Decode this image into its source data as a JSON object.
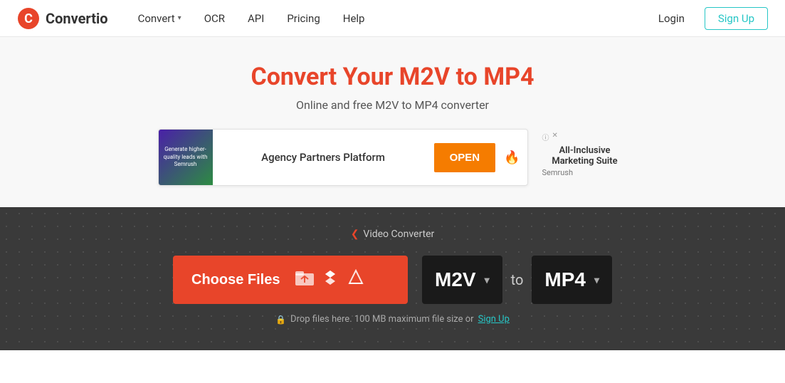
{
  "header": {
    "logo_text": "Convertio",
    "nav": [
      {
        "label": "Convert",
        "has_dropdown": true
      },
      {
        "label": "OCR",
        "has_dropdown": false
      },
      {
        "label": "API",
        "has_dropdown": false
      },
      {
        "label": "Pricing",
        "has_dropdown": false
      },
      {
        "label": "Help",
        "has_dropdown": false
      }
    ],
    "login_label": "Login",
    "signup_label": "Sign Up"
  },
  "hero": {
    "title": "Convert Your M2V to MP4",
    "subtitle": "Online and free M2V to MP4 converter"
  },
  "ad": {
    "image_text": "Generate higher-quality leads with Semrush",
    "agency_label": "Agency Partners Platform",
    "open_label": "OPEN",
    "side_title": "All-Inclusive Marketing Suite",
    "side_brand": "Semrush"
  },
  "converter": {
    "breadcrumb_label": "Video Converter",
    "choose_files_label": "Choose Files",
    "from_format": "M2V",
    "to_label": "to",
    "to_format": "MP4",
    "drop_hint": "Drop files here. 100 MB maximum file size or",
    "signup_link": "Sign Up"
  }
}
